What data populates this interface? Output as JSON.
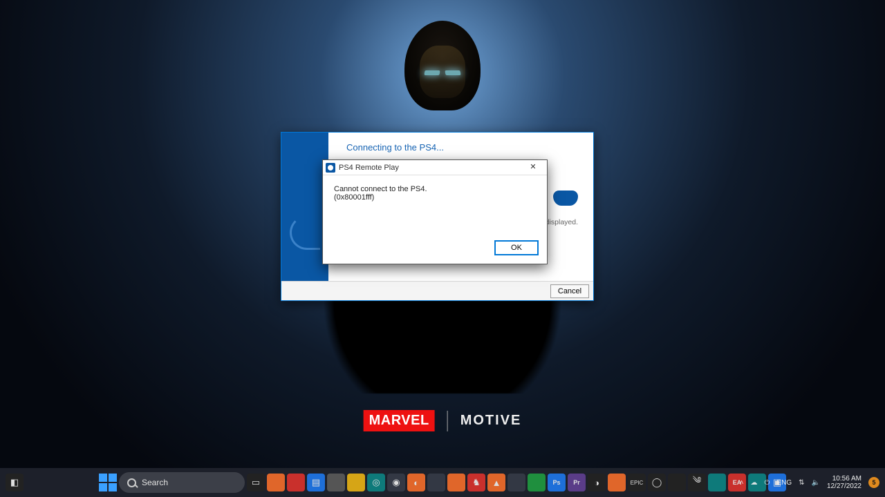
{
  "wallpaper": {
    "brand1": "MARVEL",
    "brand2": "MOTIVE"
  },
  "main_window": {
    "title": "Connecting to the PS4...",
    "screen_note": "displayed.",
    "cancel_label": "Cancel"
  },
  "error_dialog": {
    "title": "PS4 Remote Play",
    "message": "Cannot connect to the PS4.",
    "code": "(0x80001fff)",
    "ok_label": "OK"
  },
  "taskbar": {
    "search_placeholder": "Search"
  },
  "systray": {
    "lang": "ENG",
    "time": "10:56 AM",
    "date": "12/27/2022",
    "notif_badge": "5"
  }
}
